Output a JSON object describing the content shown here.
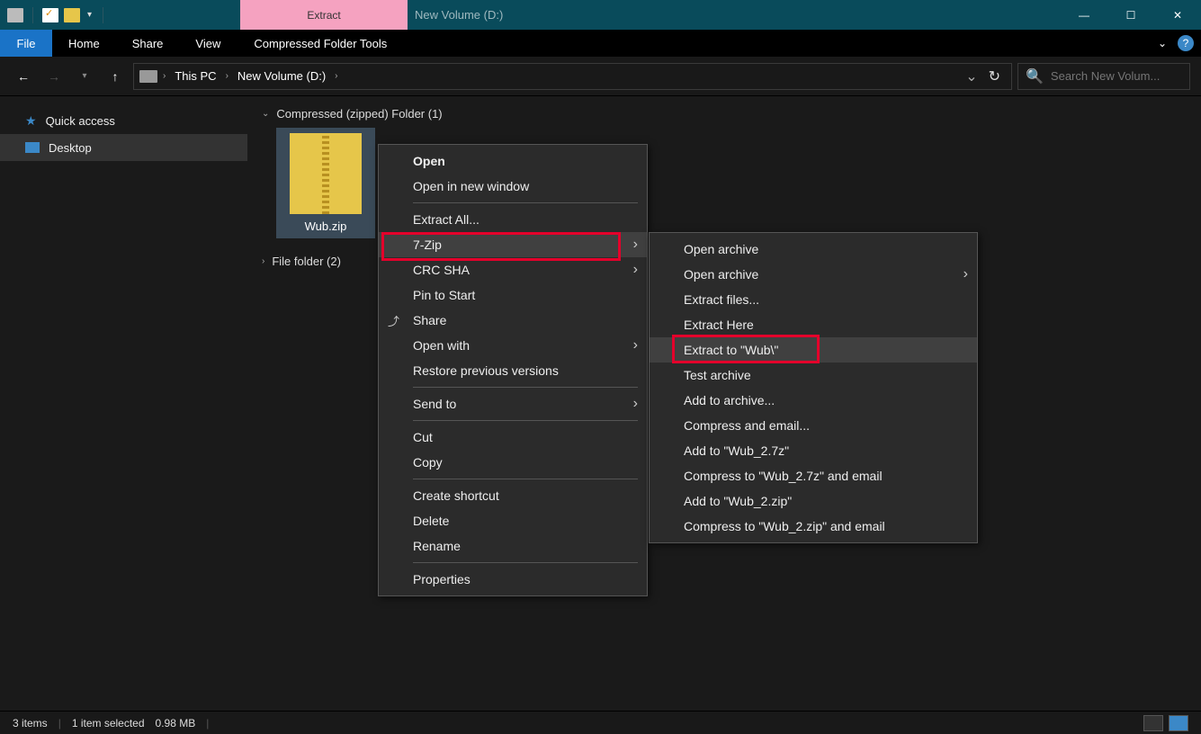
{
  "titlebar": {
    "contextual_label": "Extract",
    "window_title": "New Volume (D:)"
  },
  "ribbon": {
    "file": "File",
    "tabs": [
      "Home",
      "Share",
      "View"
    ],
    "contextual": "Compressed Folder Tools"
  },
  "breadcrumb": {
    "root": "This PC",
    "drive": "New Volume (D:)"
  },
  "search": {
    "placeholder": "Search New Volum..."
  },
  "sidebar": {
    "quick": "Quick access",
    "desktop": "Desktop"
  },
  "content": {
    "group1": "Compressed (zipped) Folder (1)",
    "file": "Wub.zip",
    "group2": "File folder (2)"
  },
  "menu1": {
    "open": "Open",
    "open_new": "Open in new window",
    "extract_all": "Extract All...",
    "seven_zip": "7-Zip",
    "crc": "CRC SHA",
    "pin": "Pin to Start",
    "share": "Share",
    "open_with": "Open with",
    "restore": "Restore previous versions",
    "send_to": "Send to",
    "cut": "Cut",
    "copy": "Copy",
    "shortcut": "Create shortcut",
    "delete": "Delete",
    "rename": "Rename",
    "properties": "Properties"
  },
  "menu2": {
    "open_arch1": "Open archive",
    "open_arch2": "Open archive",
    "extract_files": "Extract files...",
    "extract_here": "Extract Here",
    "extract_to": "Extract to \"Wub\\\"",
    "test": "Test archive",
    "add_arch": "Add to archive...",
    "comp_email": "Compress and email...",
    "add_7z": "Add to \"Wub_2.7z\"",
    "comp_7z": "Compress to \"Wub_2.7z\" and email",
    "add_zip": "Add to \"Wub_2.zip\"",
    "comp_zip": "Compress to \"Wub_2.zip\" and email"
  },
  "status": {
    "items": "3 items",
    "selected": "1 item selected",
    "size": "0.98 MB"
  }
}
